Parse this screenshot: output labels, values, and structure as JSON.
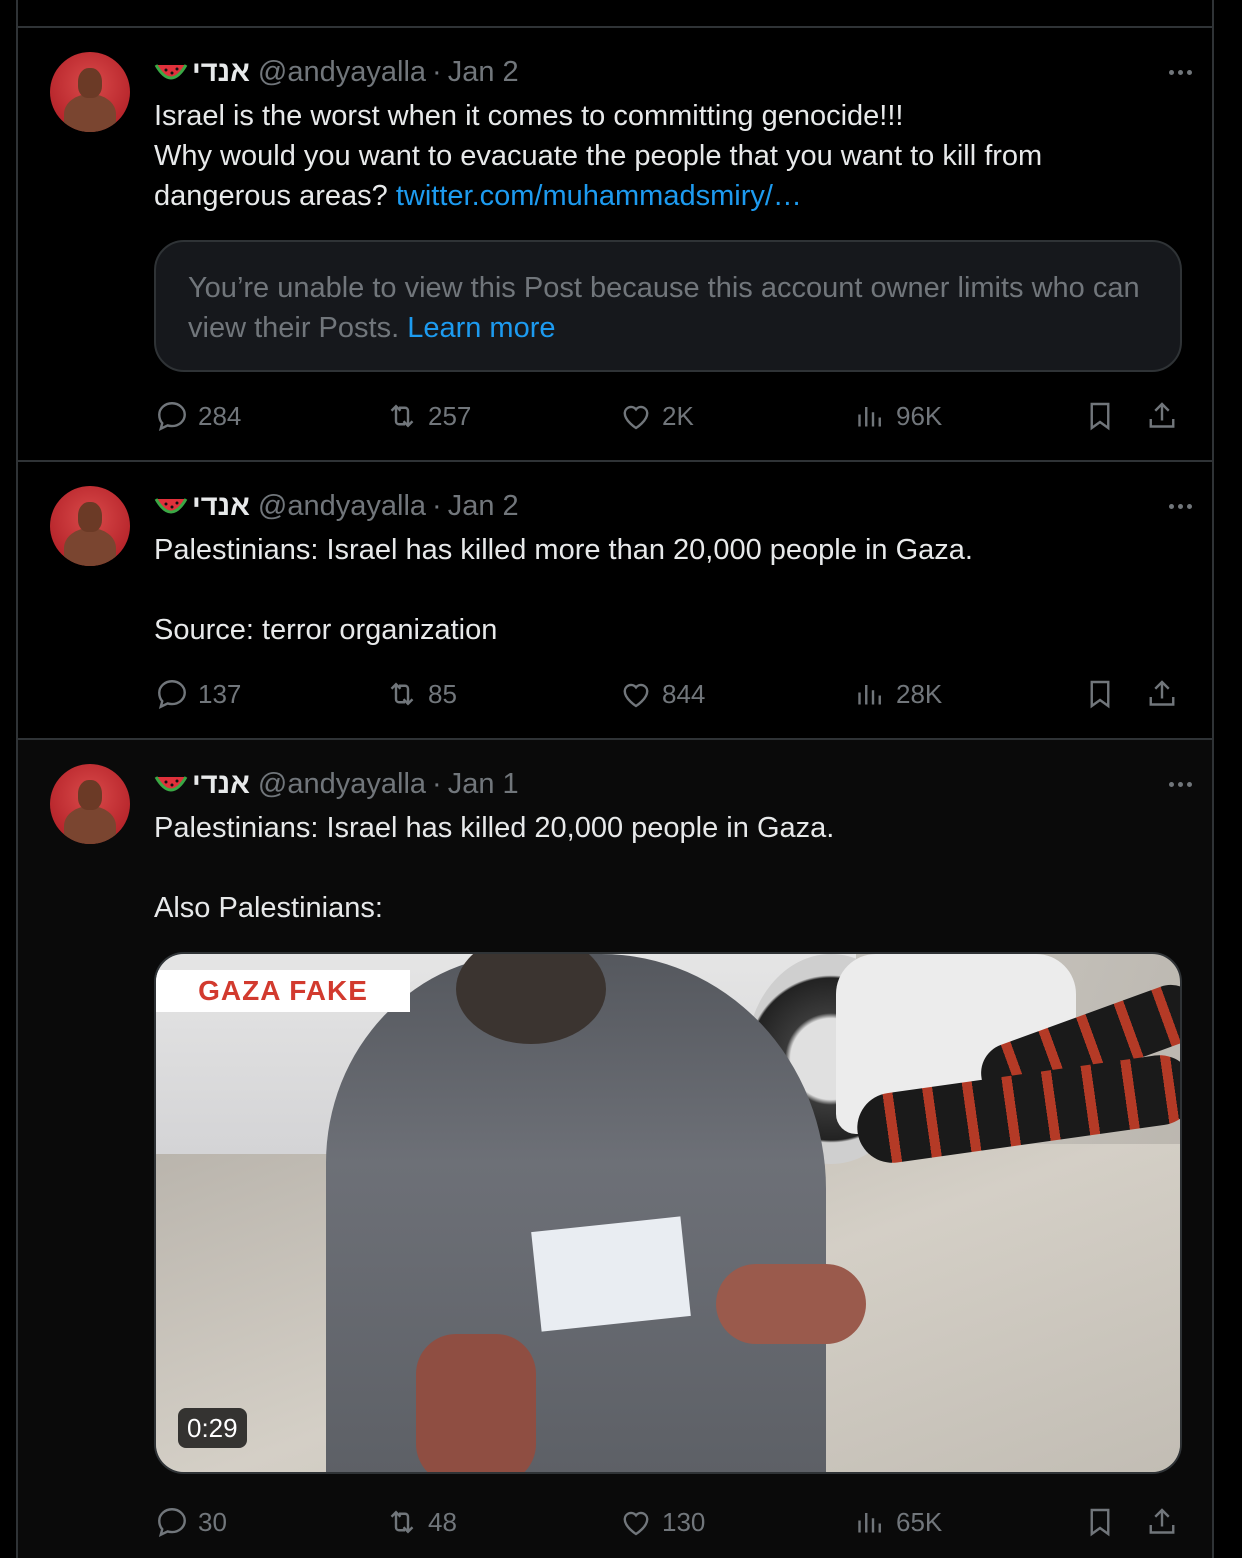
{
  "posts": [
    {
      "display_name": "אנדי",
      "handle": "@andyayalla",
      "separator": "·",
      "date": "Jan 2",
      "text": "Israel is the worst when it comes to committing genocide!!!\nWhy would you want to evacuate the people that you want to kill from dangerous areas? ",
      "link": "twitter.com/muhammadsmiry/…",
      "quote_notice": "You’re unable to view this Post because this account owner limits who can view their Posts. ",
      "quote_link": "Learn more",
      "replies": "284",
      "reposts": "257",
      "likes": "2K",
      "views": "96K"
    },
    {
      "display_name": "אנדי",
      "handle": "@andyayalla",
      "separator": "·",
      "date": "Jan 2",
      "text": "Palestinians: Israel has killed more than 20,000 people in Gaza.\n\nSource: terror organization",
      "replies": "137",
      "reposts": "85",
      "likes": "844",
      "views": "28K"
    },
    {
      "display_name": "אנדי",
      "handle": "@andyayalla",
      "separator": "·",
      "date": "Jan 1",
      "text": "Palestinians: Israel has killed 20,000 people in Gaza.\n\nAlso Palestinians:",
      "media_label": "GAZA FAKE",
      "media_duration": "0:29",
      "replies": "30",
      "reposts": "48",
      "likes": "130",
      "views": "65K"
    }
  ],
  "icons": {
    "reply": "reply-icon",
    "repost": "repost-icon",
    "like": "heart-icon",
    "views": "views-icon",
    "bookmark": "bookmark-icon",
    "share": "share-icon",
    "more": "more-icon",
    "emoji": "watermelon-icon"
  },
  "colors": {
    "background": "#000000",
    "text": "#e7e9ea",
    "secondary": "#71767b",
    "link": "#1d9bf0",
    "border": "#2f3336"
  }
}
